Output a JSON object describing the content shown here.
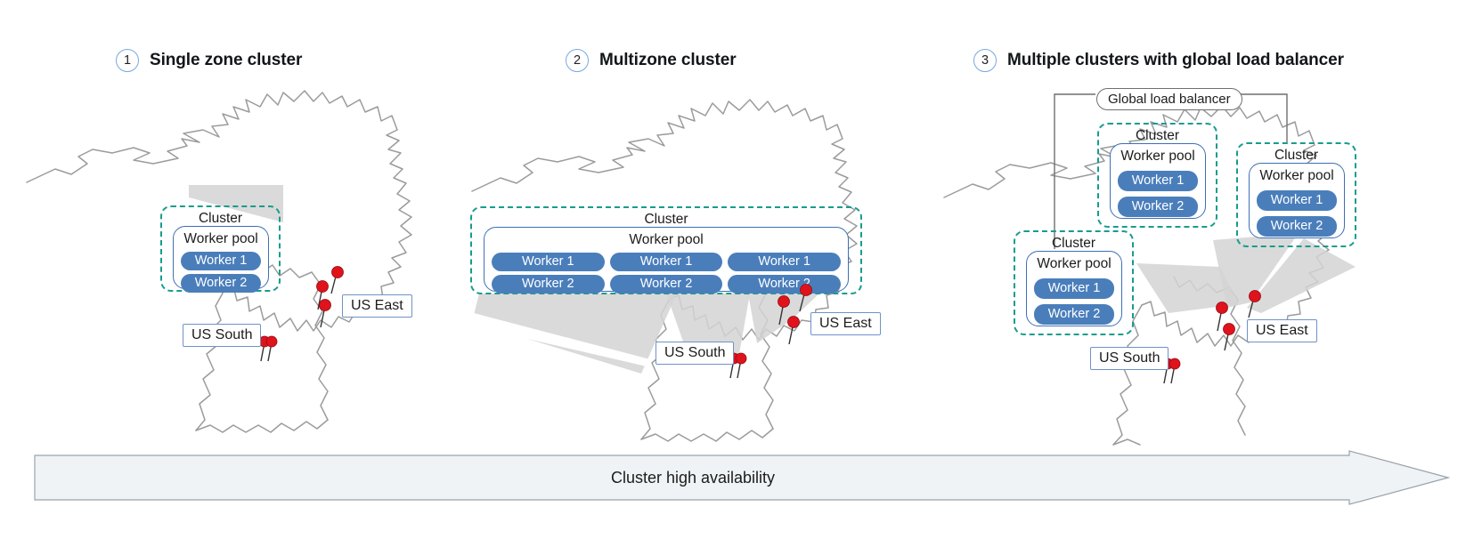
{
  "panels": [
    {
      "number": "1",
      "title": "Single zone cluster",
      "cluster_label": "Cluster",
      "pool_label": "Worker pool",
      "workers": [
        [
          "Worker 1",
          "Worker 2"
        ]
      ],
      "locations": [
        "US South",
        "US East"
      ]
    },
    {
      "number": "2",
      "title": "Multizone cluster",
      "cluster_label": "Cluster",
      "pool_label": "Worker pool",
      "workers": [
        [
          "Worker 1",
          "Worker 2"
        ],
        [
          "Worker 1",
          "Worker 2"
        ],
        [
          "Worker 1",
          "Worker 2"
        ]
      ],
      "locations": [
        "US South",
        "US East"
      ]
    },
    {
      "number": "3",
      "title": "Multiple clusters with global load balancer",
      "global_load_balancer": "Global load balancer",
      "clusters": [
        {
          "cluster_label": "Cluster",
          "pool_label": "Worker pool",
          "workers": [
            [
              "Worker 1",
              "Worker 2"
            ]
          ]
        },
        {
          "cluster_label": "Cluster",
          "pool_label": "Worker pool",
          "workers": [
            [
              "Worker 1",
              "Worker 2"
            ]
          ]
        },
        {
          "cluster_label": "Cluster",
          "pool_label": "Worker pool",
          "workers": [
            [
              "Worker 1",
              "Worker 2"
            ]
          ]
        }
      ],
      "locations": [
        "US South",
        "US East"
      ]
    }
  ],
  "footer": {
    "arrow_label": "Cluster high availability"
  },
  "colors": {
    "cluster_border": "#179c8e",
    "pool_border": "#3d6fb5",
    "worker_fill": "#4a7ebb",
    "pin": "#e0121c",
    "map_stroke": "#9b9b9b",
    "beam": "#d3d3d3",
    "arrow_fill": "#eff3f6",
    "badge_border": "#78a9e0"
  }
}
